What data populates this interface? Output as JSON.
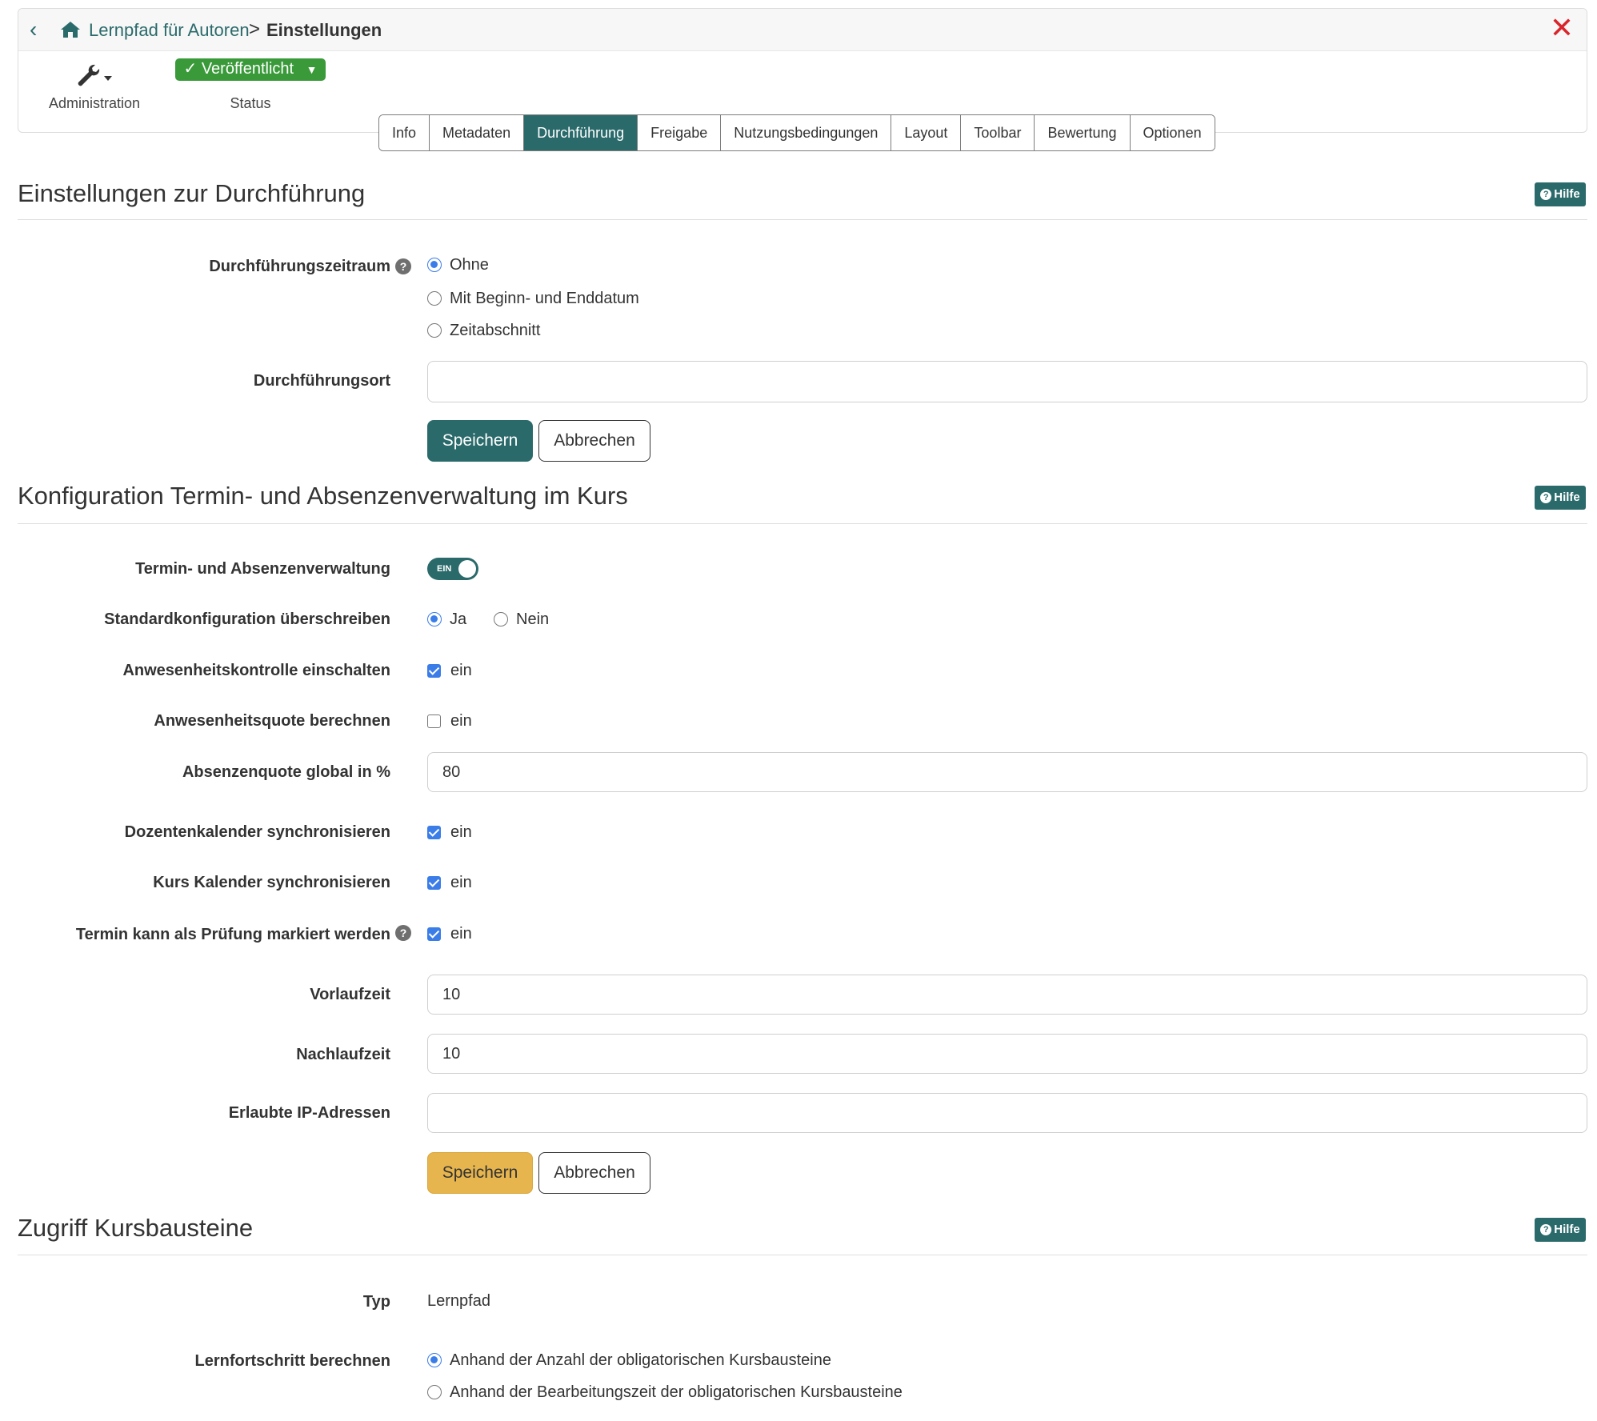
{
  "breadcrumb": {
    "back_icon": "chevron-left-icon",
    "home_icon": "home-icon",
    "course": "Lernpfad für Autoren",
    "separator": ">",
    "current": "Einstellungen",
    "close_icon": "close-icon"
  },
  "toolbar": {
    "admin_label": "Administration",
    "status_value": "Veröffentlicht",
    "status_label": "Status"
  },
  "tabs": [
    "Info",
    "Metadaten",
    "Durchführung",
    "Freigabe",
    "Nutzungsbedingungen",
    "Layout",
    "Toolbar",
    "Bewertung",
    "Optionen"
  ],
  "active_tab": "Durchführung",
  "help_label": "Hilfe",
  "section1": {
    "title": "Einstellungen zur Durchführung",
    "period_label": "Durchführungszeitraum",
    "period_options": [
      "Ohne",
      "Mit Beginn- und Enddatum",
      "Zeitabschnitt"
    ],
    "period_selected": "Ohne",
    "place_label": "Durchführungsort",
    "place_value": "",
    "save": "Speichern",
    "cancel": "Abbrechen"
  },
  "section2": {
    "title": "Konfiguration Termin- und Absenzenverwaltung im Kurs",
    "mgmt_label": "Termin- und Absenzenverwaltung",
    "toggle_text": "EIN",
    "override_label": "Standardkonfiguration überschreiben",
    "override_yes": "Ja",
    "override_no": "Nein",
    "override_selected": "Ja",
    "attendance_label": "Anwesenheitskontrolle einschalten",
    "attendance_checked": true,
    "quota_calc_label": "Anwesenheitsquote berechnen",
    "quota_calc_checked": false,
    "absence_quota_label": "Absenzenquote global in %",
    "absence_quota_value": "80",
    "teacher_cal_label": "Dozentenkalender synchronisieren",
    "teacher_cal_checked": true,
    "course_cal_label": "Kurs Kalender synchronisieren",
    "course_cal_checked": true,
    "exam_label": "Termin kann als Prüfung markiert werden",
    "exam_checked": true,
    "check_text": "ein",
    "lead_label": "Vorlaufzeit",
    "lead_value": "10",
    "follow_label": "Nachlaufzeit",
    "follow_value": "10",
    "ip_label": "Erlaubte IP-Adressen",
    "ip_value": "",
    "save": "Speichern",
    "cancel": "Abbrechen"
  },
  "section3": {
    "title": "Zugriff Kursbausteine",
    "type_label": "Typ",
    "type_value": "Lernpfad",
    "progress_label": "Lernfortschritt berechnen",
    "progress_options": [
      "Anhand der Anzahl der obligatorischen Kursbausteine",
      "Anhand der Bearbeitungszeit der obligatorischen Kursbausteine"
    ],
    "progress_selected": "Anhand der Anzahl der obligatorischen Kursbausteine"
  },
  "colors": {
    "primary": "#2b6a6b",
    "status_green": "#3a9a3a",
    "dirty_button": "#e6b54e",
    "close_red": "#d9242b",
    "radio_blue": "#3b7de8"
  }
}
